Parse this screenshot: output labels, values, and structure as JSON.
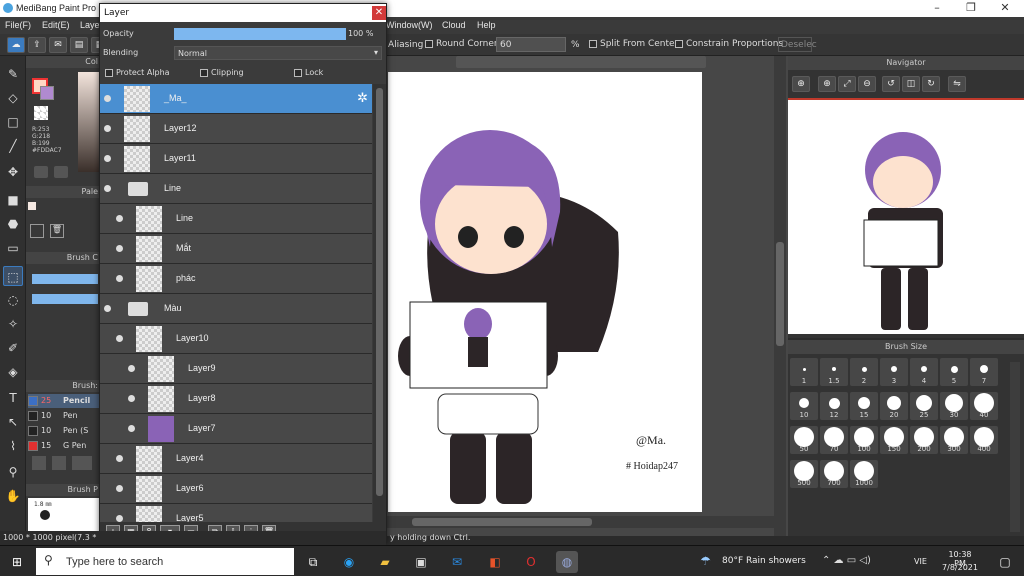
{
  "app": {
    "title": "MediBang Paint Pro"
  },
  "menu": {
    "items": [
      "File(F)",
      "Edit(E)",
      "Laye",
      "Window(W)",
      "Cloud",
      "Help"
    ]
  },
  "toolbar": {
    "antialiasing": "Aliasing",
    "round_corners": "Round Corners",
    "round_value": "60",
    "pct": "%",
    "from_center": "Split From Center",
    "constrain": "Constrain Proportions",
    "deselect": "Deselec"
  },
  "color": {
    "title": "Col",
    "r": "R:253",
    "g": "G:218",
    "b": "B:199",
    "hex": "#FDDAC7",
    "palette_title": "Pale",
    "brushc_title": "Brush C",
    "brush_title": "Brush:",
    "brushp_title": "Brush P",
    "brush_size_readout": "1.8 ㎜"
  },
  "brushes": [
    {
      "size": "25",
      "name": "Pencil",
      "color": "#3c6fc4",
      "selected": true
    },
    {
      "size": "10",
      "name": "Pen",
      "color": "#222222"
    },
    {
      "size": "10",
      "name": "Pen (S",
      "color": "#222222"
    },
    {
      "size": "15",
      "name": "G Pen",
      "color": "#e03030"
    }
  ],
  "layer_panel": {
    "title": "Layer",
    "opacity_label": "Opacity",
    "opacity_value": "100 %",
    "opacity_pct": 100,
    "blending_label": "Blending",
    "blending_value": "Normal",
    "protect_alpha": "Protect Alpha",
    "clipping": "Clipping",
    "lock": "Lock",
    "layers": [
      {
        "name": "_Ma_",
        "indent": 0,
        "type": "layer",
        "selected": true
      },
      {
        "name": "Layer12",
        "indent": 0,
        "type": "layer"
      },
      {
        "name": "Layer11",
        "indent": 0,
        "type": "layer"
      },
      {
        "name": "Line",
        "indent": 0,
        "type": "folder"
      },
      {
        "name": "Line",
        "indent": 1,
        "type": "layer"
      },
      {
        "name": "Mắt",
        "indent": 1,
        "type": "layer"
      },
      {
        "name": "phác",
        "indent": 1,
        "type": "layer"
      },
      {
        "name": "Màu",
        "indent": 0,
        "type": "folder"
      },
      {
        "name": "Layer10",
        "indent": 1,
        "type": "layer"
      },
      {
        "name": "Layer9",
        "indent": 2,
        "type": "layer"
      },
      {
        "name": "Layer8",
        "indent": 2,
        "type": "layer"
      },
      {
        "name": "Layer7",
        "indent": 2,
        "type": "purple"
      },
      {
        "name": "Layer4",
        "indent": 1,
        "type": "layer"
      },
      {
        "name": "Layer6",
        "indent": 1,
        "type": "layer"
      },
      {
        "name": "Layer5",
        "indent": 1,
        "type": "layer"
      }
    ]
  },
  "navigator": {
    "title": "Navigator"
  },
  "brush_size": {
    "title": "Brush Size",
    "values": [
      "1",
      "1.5",
      "2",
      "3",
      "4",
      "5",
      "7",
      "10",
      "12",
      "15",
      "20",
      "25",
      "30",
      "40",
      "50",
      "70",
      "100",
      "150",
      "200",
      "300",
      "400",
      "500",
      "700",
      "1000"
    ]
  },
  "canvas": {
    "sign": "@Ma.",
    "tag": "# Hoidap247"
  },
  "status": {
    "size": "1000 * 1000 pixel",
    "extra": "(7.3 *",
    "hint": "y holding down Ctrl."
  },
  "taskbar": {
    "search_placeholder": "Type here to search",
    "weather": "80°F  Rain showers",
    "lang": "VIE",
    "time": "10:38 PM",
    "date": "7/8/2021"
  }
}
